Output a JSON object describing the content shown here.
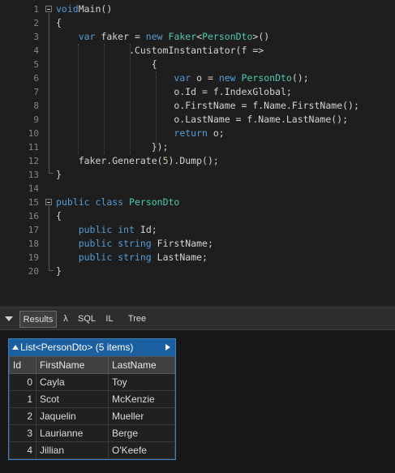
{
  "editor": {
    "lines": [
      {
        "n": "1",
        "fold": true,
        "t": [
          [
            "kw",
            "void"
          ],
          [
            "",
            "Main()"
          ]
        ]
      },
      {
        "n": "2",
        "t": [
          [
            "",
            "{"
          ]
        ]
      },
      {
        "n": "3",
        "t": [
          [
            "",
            "    "
          ],
          [
            "kw",
            "var"
          ],
          [
            "",
            " faker = "
          ],
          [
            "kw",
            "new"
          ],
          [
            "",
            " "
          ],
          [
            "ty",
            "Faker"
          ],
          [
            "",
            "<"
          ],
          [
            "ty",
            "PersonDto"
          ],
          [
            "",
            ">()"
          ]
        ]
      },
      {
        "n": "4",
        "t": [
          [
            "",
            "             .CustomInstantiator(f =>"
          ]
        ]
      },
      {
        "n": "5",
        "t": [
          [
            "",
            "                 {"
          ]
        ]
      },
      {
        "n": "6",
        "t": [
          [
            "",
            "                     "
          ],
          [
            "kw",
            "var"
          ],
          [
            "",
            " o = "
          ],
          [
            "kw",
            "new"
          ],
          [
            "",
            " "
          ],
          [
            "ty",
            "PersonDto"
          ],
          [
            "",
            "();"
          ]
        ]
      },
      {
        "n": "7",
        "t": [
          [
            "",
            "                     o.Id = f.IndexGlobal;"
          ]
        ]
      },
      {
        "n": "8",
        "t": [
          [
            "",
            "                     o.FirstName = f.Name.FirstName();"
          ]
        ]
      },
      {
        "n": "9",
        "t": [
          [
            "",
            "                     o.LastName = f.Name.LastName();"
          ]
        ]
      },
      {
        "n": "10",
        "t": [
          [
            "",
            "                     "
          ],
          [
            "kw",
            "return"
          ],
          [
            "",
            " o;"
          ]
        ]
      },
      {
        "n": "11",
        "t": [
          [
            "",
            "                 });"
          ]
        ]
      },
      {
        "n": "12",
        "t": [
          [
            "",
            "    faker.Generate("
          ],
          [
            "nm",
            "5"
          ],
          [
            "",
            ").Dump();"
          ]
        ]
      },
      {
        "n": "13",
        "t": [
          [
            "",
            "}"
          ]
        ]
      },
      {
        "n": "14",
        "t": []
      },
      {
        "n": "15",
        "fold": true,
        "t": [
          [
            "kw",
            "public"
          ],
          [
            "",
            " "
          ],
          [
            "kw",
            "class"
          ],
          [
            "",
            " "
          ],
          [
            "ty",
            "PersonDto"
          ]
        ]
      },
      {
        "n": "16",
        "t": [
          [
            "",
            "{"
          ]
        ]
      },
      {
        "n": "17",
        "t": [
          [
            "",
            "    "
          ],
          [
            "kw",
            "public"
          ],
          [
            "",
            " "
          ],
          [
            "kw",
            "int"
          ],
          [
            "",
            " Id;"
          ]
        ]
      },
      {
        "n": "18",
        "t": [
          [
            "",
            "    "
          ],
          [
            "kw",
            "public"
          ],
          [
            "",
            " "
          ],
          [
            "kw",
            "string"
          ],
          [
            "",
            " FirstName;"
          ]
        ]
      },
      {
        "n": "19",
        "t": [
          [
            "",
            "    "
          ],
          [
            "kw",
            "public"
          ],
          [
            "",
            " "
          ],
          [
            "kw",
            "string"
          ],
          [
            "",
            " LastName;"
          ]
        ]
      },
      {
        "n": "20",
        "t": [
          [
            "",
            "}"
          ]
        ]
      }
    ]
  },
  "results_bar": {
    "tabs": [
      "Results",
      "λ",
      "SQL",
      "IL",
      "Tree"
    ],
    "active": "Results"
  },
  "results": {
    "title": "List<PersonDto> (5 items)",
    "columns": [
      "Id",
      "FirstName",
      "LastName"
    ],
    "rows": [
      [
        "0",
        "Cayla",
        "Toy"
      ],
      [
        "1",
        "Scot",
        "McKenzie"
      ],
      [
        "2",
        "Jaquelin",
        "Mueller"
      ],
      [
        "3",
        "Laurianne",
        "Berge"
      ],
      [
        "4",
        "Jillian",
        "O'Keefe"
      ]
    ]
  },
  "colors": {
    "keyword": "#569cd6",
    "type": "#4ec9b0",
    "number": "#b5cea8",
    "table_header": "#1c5fa0"
  }
}
